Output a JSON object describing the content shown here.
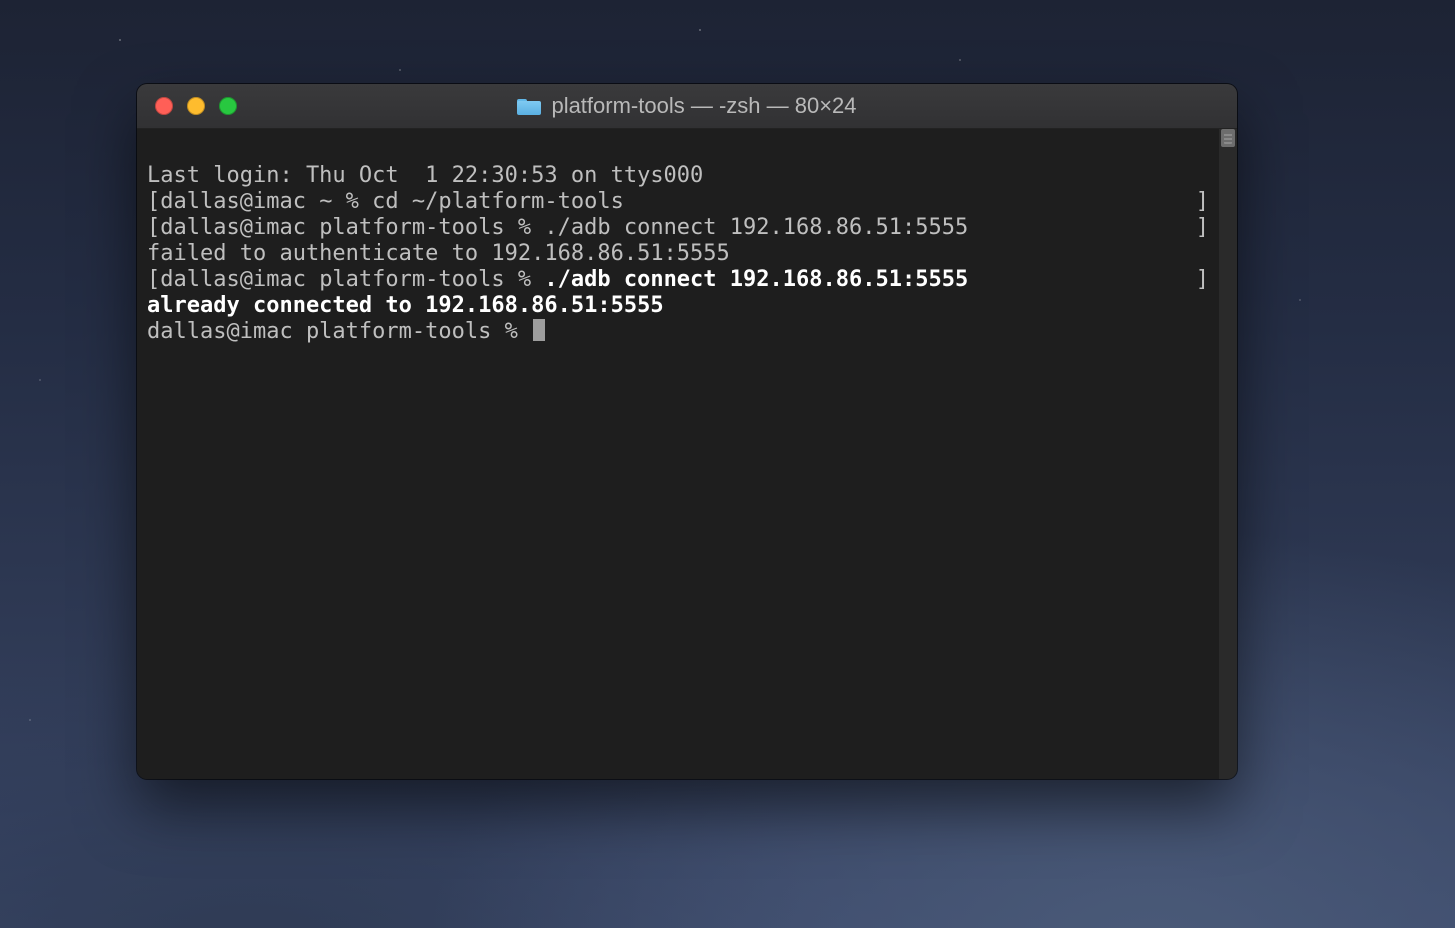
{
  "window": {
    "title": "platform-tools — -zsh — 80×24"
  },
  "terminal": {
    "lines": [
      {
        "type": "plain",
        "text": "Last login: Thu Oct  1 22:30:53 on ttys000"
      },
      {
        "type": "bracket",
        "text": "dallas@imac ~ % cd ~/platform-tools"
      },
      {
        "type": "bracket",
        "text": "dallas@imac platform-tools % ./adb connect 192.168.86.51:5555"
      },
      {
        "type": "plain",
        "text": "failed to authenticate to 192.168.86.51:5555"
      },
      {
        "type": "bracket",
        "prompt": "dallas@imac platform-tools % ",
        "bold": "./adb connect 192.168.86.51:5555"
      },
      {
        "type": "bold",
        "text": "already connected to 192.168.86.51:5555"
      },
      {
        "type": "prompt",
        "text": "dallas@imac platform-tools % "
      }
    ]
  }
}
